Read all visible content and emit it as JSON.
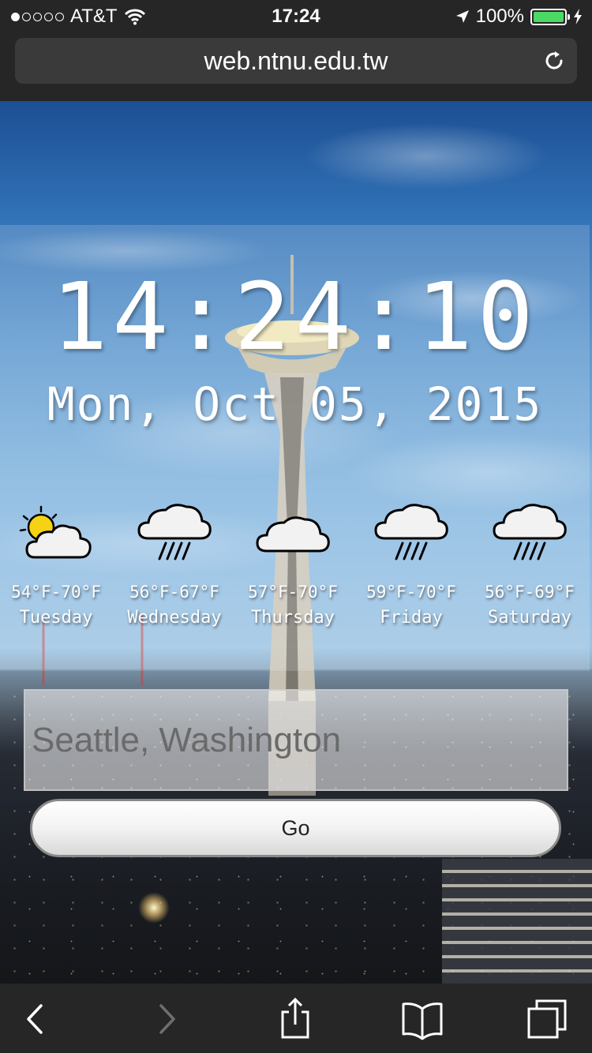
{
  "status_bar": {
    "carrier": "AT&T",
    "time": "17:24",
    "battery": "100%",
    "signal_bars_filled": 1,
    "signal_bars_total": 5
  },
  "browser": {
    "url": "web.ntnu.edu.tw",
    "icons": [
      "reload-icon",
      "back-icon",
      "forward-icon",
      "share-icon",
      "bookmarks-icon",
      "tabs-icon"
    ]
  },
  "clock": {
    "time": "14:24:10",
    "date": "Mon, Oct 05, 2015"
  },
  "forecast": [
    {
      "icon": "partly-cloudy-icon",
      "temp": "54°F-70°F",
      "day": "Tuesday"
    },
    {
      "icon": "rain-icon",
      "temp": "56°F-67°F",
      "day": "Wednesday"
    },
    {
      "icon": "cloudy-icon",
      "temp": "57°F-70°F",
      "day": "Thursday"
    },
    {
      "icon": "rain-icon",
      "temp": "59°F-70°F",
      "day": "Friday"
    },
    {
      "icon": "rain-icon",
      "temp": "56°F-69°F",
      "day": "Saturday"
    }
  ],
  "search": {
    "placeholder": "Seattle, Washington",
    "button_label": "Go"
  },
  "colors": {
    "chrome": "#262626",
    "battery_fill": "#4cd964"
  }
}
